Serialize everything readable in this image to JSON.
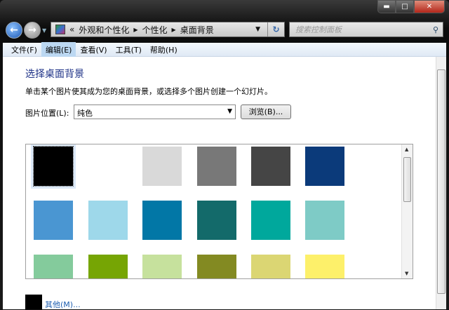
{
  "window": {
    "caption_buttons": [
      "minimize",
      "maximize",
      "close"
    ]
  },
  "address_bar": {
    "overflow": "«",
    "crumbs": [
      "外观和个性化",
      "个性化",
      "桌面背景"
    ]
  },
  "search": {
    "placeholder": "搜索控制面板"
  },
  "menu": [
    {
      "label": "文件(F)"
    },
    {
      "label": "编辑(E)",
      "active": true
    },
    {
      "label": "查看(V)"
    },
    {
      "label": "工具(T)"
    },
    {
      "label": "帮助(H)"
    }
  ],
  "main": {
    "title": "选择桌面背景",
    "description": "单击某个图片使其成为您的桌面背景，或选择多个图片创建一个幻灯片。",
    "position_label": "图片位置(L):",
    "position_value": "纯色",
    "browse_label": "浏览(B)...",
    "colors": [
      [
        "#000000",
        "#ffffff",
        "#d9d9d9",
        "#787878",
        "#454545",
        "#0b3a7a"
      ],
      [
        "#4a96d2",
        "#9ed8ea",
        "#0277a6",
        "#136a6a",
        "#00a89c",
        "#7ecbc6"
      ],
      [
        "#84cb9c",
        "#76a504",
        "#c6e19d",
        "#838a22",
        "#dbd673",
        "#fdf06a"
      ]
    ],
    "selected_color": "#000000",
    "other_label": "其他(M)..."
  }
}
